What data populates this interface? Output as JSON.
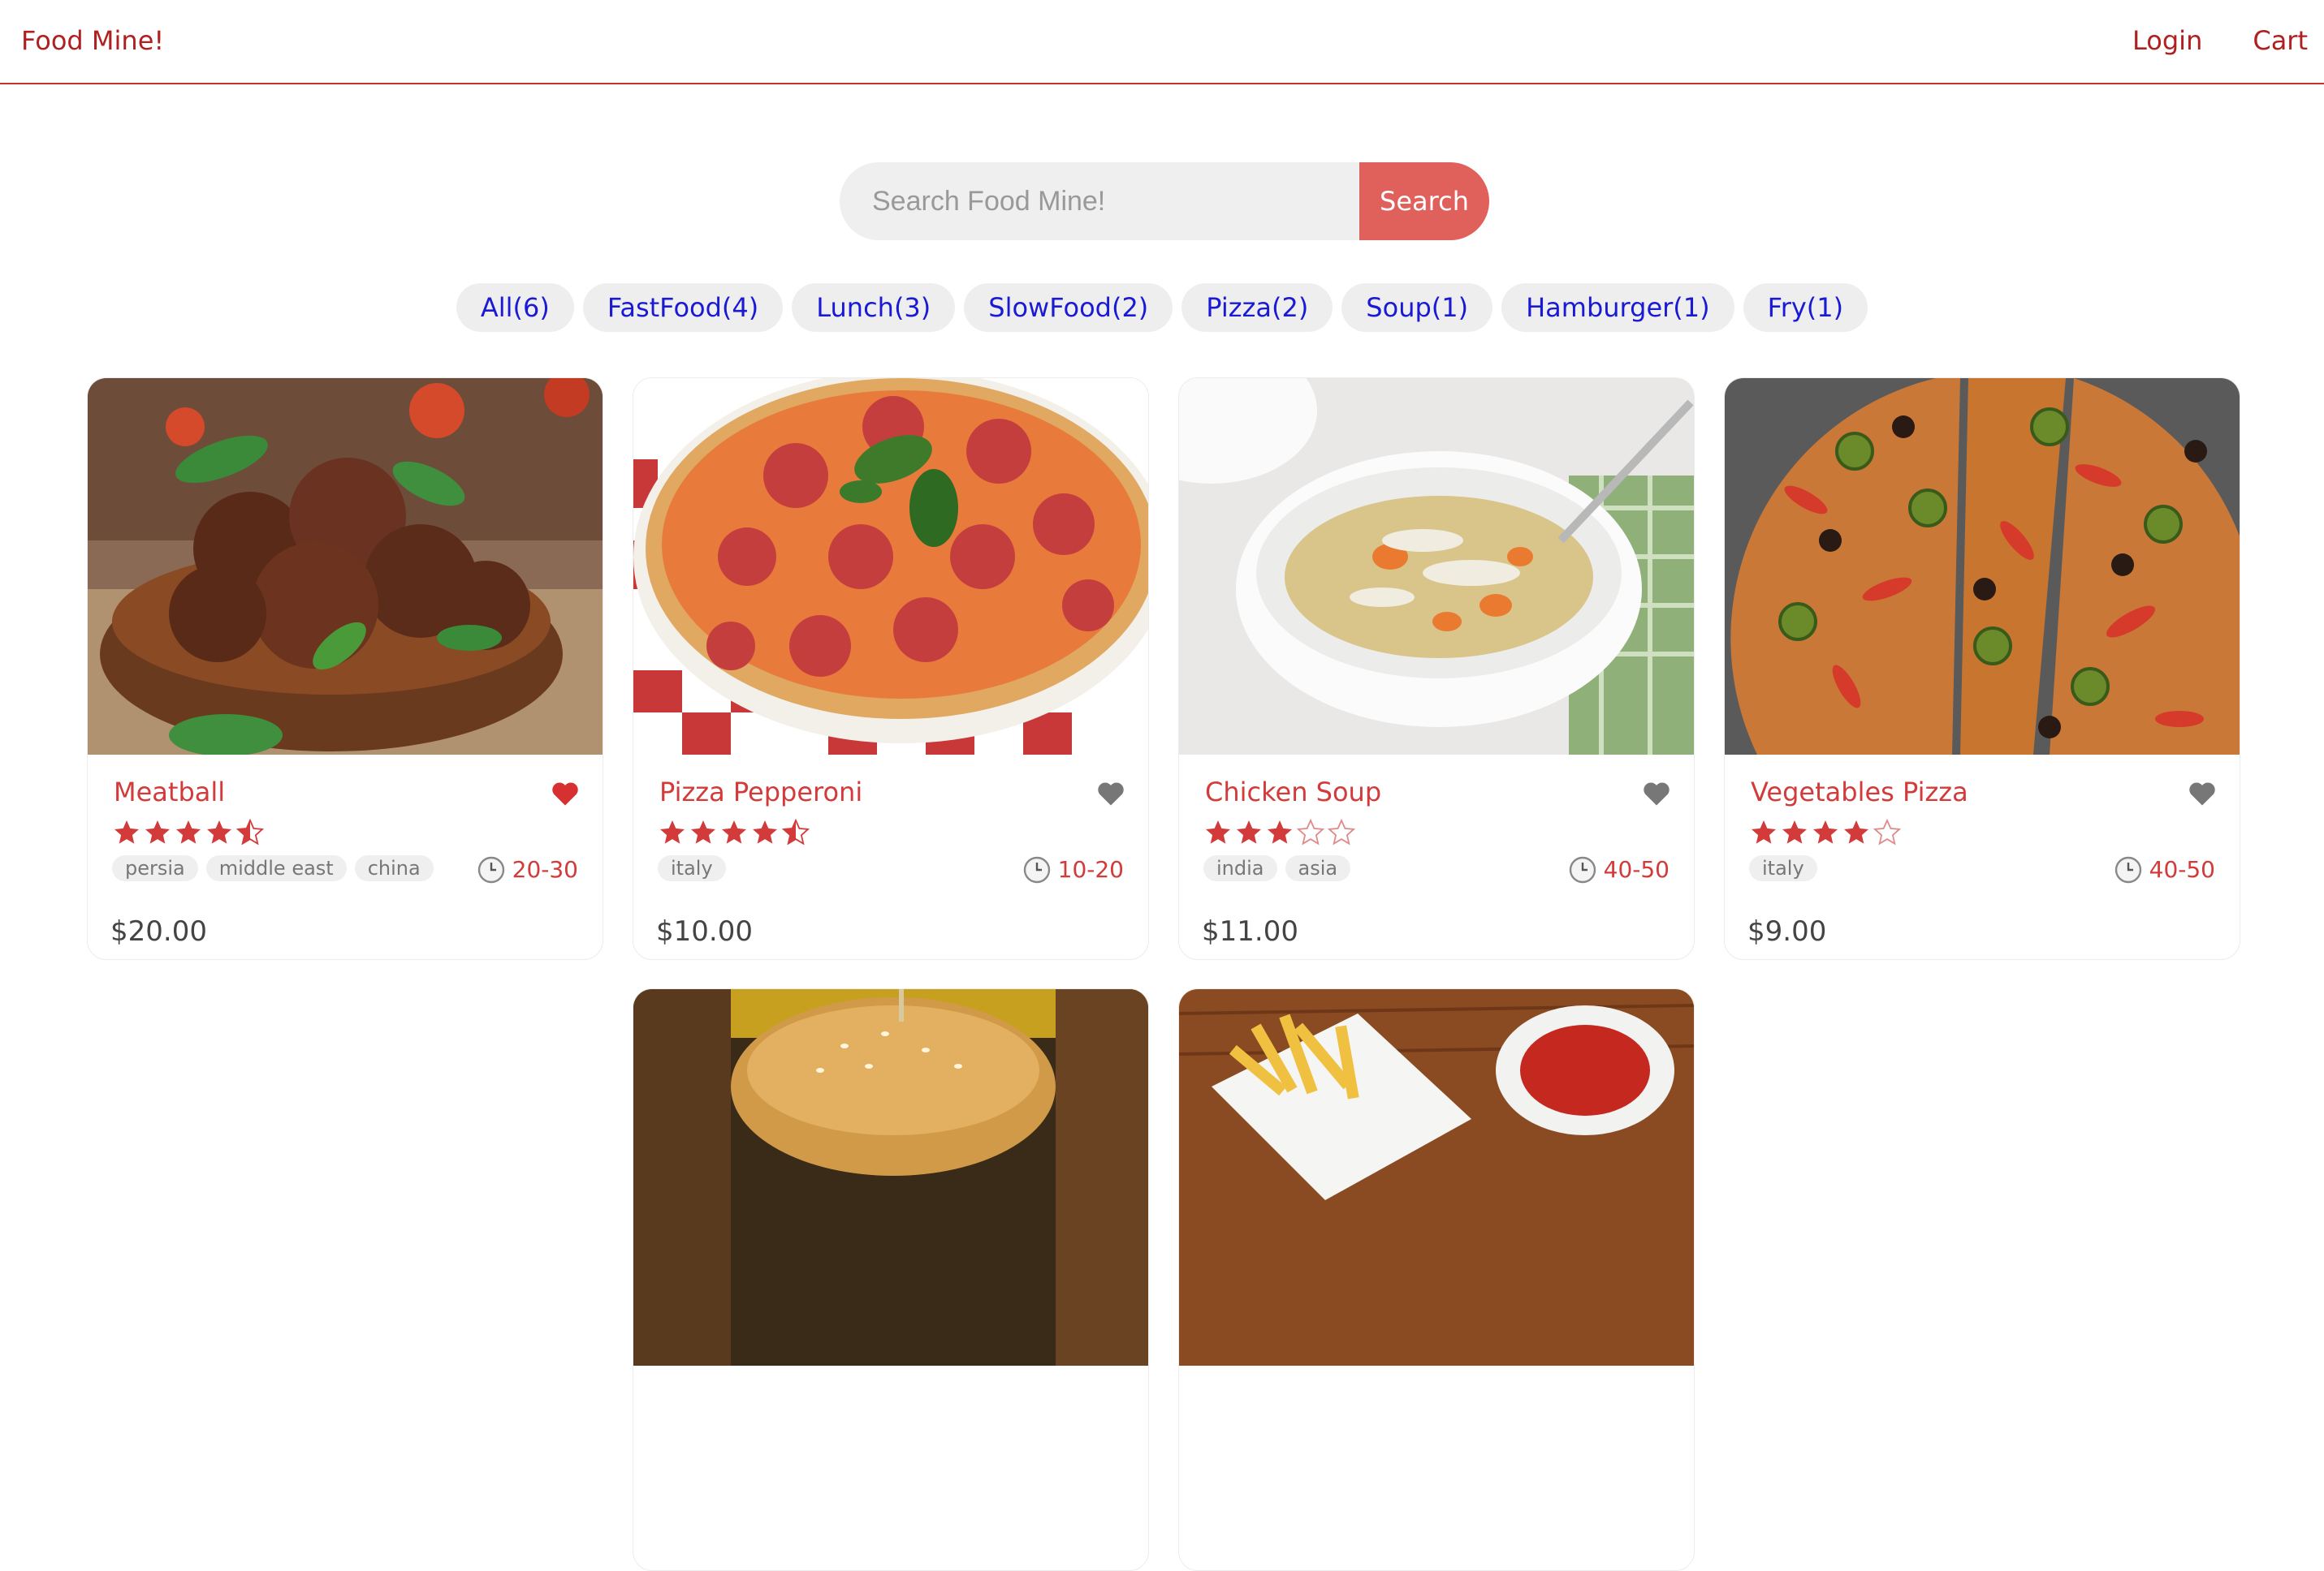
{
  "header": {
    "logo": "Food Mine!",
    "nav": {
      "login": "Login",
      "cart": "Cart"
    }
  },
  "search": {
    "placeholder": "Search Food Mine!",
    "button": "Search"
  },
  "tags": [
    "All(6)",
    "FastFood(4)",
    "Lunch(3)",
    "SlowFood(2)",
    "Pizza(2)",
    "Soup(1)",
    "Hamburger(1)",
    "Fry(1)"
  ],
  "colors": {
    "brand": "#b02020",
    "accent": "#e0605b",
    "tag_text": "#1a1ad4",
    "favorite_active": "#d63031",
    "favorite_inactive": "#777777"
  },
  "foods": [
    {
      "name": "Meatball",
      "stars": 4.5,
      "favorite": true,
      "origins": [
        "persia",
        "middle east",
        "china"
      ],
      "cook_time": "20-30",
      "price": "$20.00",
      "image": "meatball-bowl-photo"
    },
    {
      "name": "Pizza Pepperoni",
      "stars": 4.5,
      "favorite": false,
      "origins": [
        "italy"
      ],
      "cook_time": "10-20",
      "price": "$10.00",
      "image": "pepperoni-pizza-photo"
    },
    {
      "name": "Chicken Soup",
      "stars": 3,
      "favorite": false,
      "origins": [
        "india",
        "asia"
      ],
      "cook_time": "40-50",
      "price": "$11.00",
      "image": "chicken-soup-photo"
    },
    {
      "name": "Vegetables Pizza",
      "stars": 4,
      "favorite": false,
      "origins": [
        "italy"
      ],
      "cook_time": "40-50",
      "price": "$9.00",
      "image": "vegetable-pizza-photo"
    },
    {
      "image": "hamburger-photo"
    },
    {
      "image": "french-fries-photo"
    }
  ]
}
